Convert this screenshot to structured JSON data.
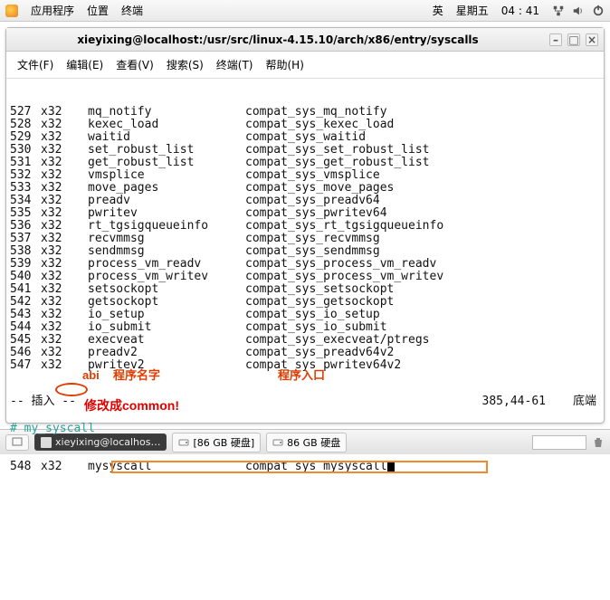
{
  "top": {
    "apps": "应用程序",
    "places": "位置",
    "terminal": "终端",
    "lang": "英",
    "day": "星期五",
    "time": "04 : 41"
  },
  "win": {
    "title": "xieyixing@localhost:/usr/src/linux-4.15.10/arch/x86/entry/syscalls",
    "menu": {
      "file": "文件(F)",
      "edit": "编辑(E)",
      "view": "查看(V)",
      "search": "搜索(S)",
      "terminal": "终端(T)",
      "help": "帮助(H)"
    }
  },
  "rows": [
    {
      "n": "527",
      "abi": "x32",
      "name": "mq_notify",
      "entry": "compat_sys_mq_notify"
    },
    {
      "n": "528",
      "abi": "x32",
      "name": "kexec_load",
      "entry": "compat_sys_kexec_load"
    },
    {
      "n": "529",
      "abi": "x32",
      "name": "waitid",
      "entry": "compat_sys_waitid"
    },
    {
      "n": "530",
      "abi": "x32",
      "name": "set_robust_list",
      "entry": "compat_sys_set_robust_list"
    },
    {
      "n": "531",
      "abi": "x32",
      "name": "get_robust_list",
      "entry": "compat_sys_get_robust_list"
    },
    {
      "n": "532",
      "abi": "x32",
      "name": "vmsplice",
      "entry": "compat_sys_vmsplice"
    },
    {
      "n": "533",
      "abi": "x32",
      "name": "move_pages",
      "entry": "compat_sys_move_pages"
    },
    {
      "n": "534",
      "abi": "x32",
      "name": "preadv",
      "entry": "compat_sys_preadv64"
    },
    {
      "n": "535",
      "abi": "x32",
      "name": "pwritev",
      "entry": "compat_sys_pwritev64"
    },
    {
      "n": "536",
      "abi": "x32",
      "name": "rt_tgsigqueueinfo",
      "entry": "compat_sys_rt_tgsigqueueinfo"
    },
    {
      "n": "537",
      "abi": "x32",
      "name": "recvmmsg",
      "entry": "compat_sys_recvmmsg"
    },
    {
      "n": "538",
      "abi": "x32",
      "name": "sendmmsg",
      "entry": "compat_sys_sendmmsg"
    },
    {
      "n": "539",
      "abi": "x32",
      "name": "process_vm_readv",
      "entry": "compat_sys_process_vm_readv"
    },
    {
      "n": "540",
      "abi": "x32",
      "name": "process_vm_writev",
      "entry": "compat_sys_process_vm_writev"
    },
    {
      "n": "541",
      "abi": "x32",
      "name": "setsockopt",
      "entry": "compat_sys_setsockopt"
    },
    {
      "n": "542",
      "abi": "x32",
      "name": "getsockopt",
      "entry": "compat_sys_getsockopt"
    },
    {
      "n": "543",
      "abi": "x32",
      "name": "io_setup",
      "entry": "compat_sys_io_setup"
    },
    {
      "n": "544",
      "abi": "x32",
      "name": "io_submit",
      "entry": "compat_sys_io_submit"
    },
    {
      "n": "545",
      "abi": "x32",
      "name": "execveat",
      "entry": "compat_sys_execveat/ptregs"
    },
    {
      "n": "546",
      "abi": "x32",
      "name": "preadv2",
      "entry": "compat_sys_preadv64v2"
    },
    {
      "n": "547",
      "abi": "x32",
      "name": "pwritev2",
      "entry": "compat_sys_pwritev64v2"
    }
  ],
  "comment_line": "# my_syscall",
  "edit_row": {
    "n": "548",
    "abi": "x32",
    "name": "mysyscall",
    "entry": "compat_sys_mysyscall"
  },
  "anno": {
    "abi": "abi",
    "progname": "程序名字",
    "entry": "程序入口",
    "change": "修改成common!"
  },
  "status": {
    "mode": "-- 插入 --",
    "pos": "385,44-61",
    "pct": "底端"
  },
  "task": {
    "desk": "⬚",
    "term": "xieyixing@localhos…",
    "disk1": "[86 GB 硬盘]",
    "disk2": "86 GB 硬盘"
  }
}
